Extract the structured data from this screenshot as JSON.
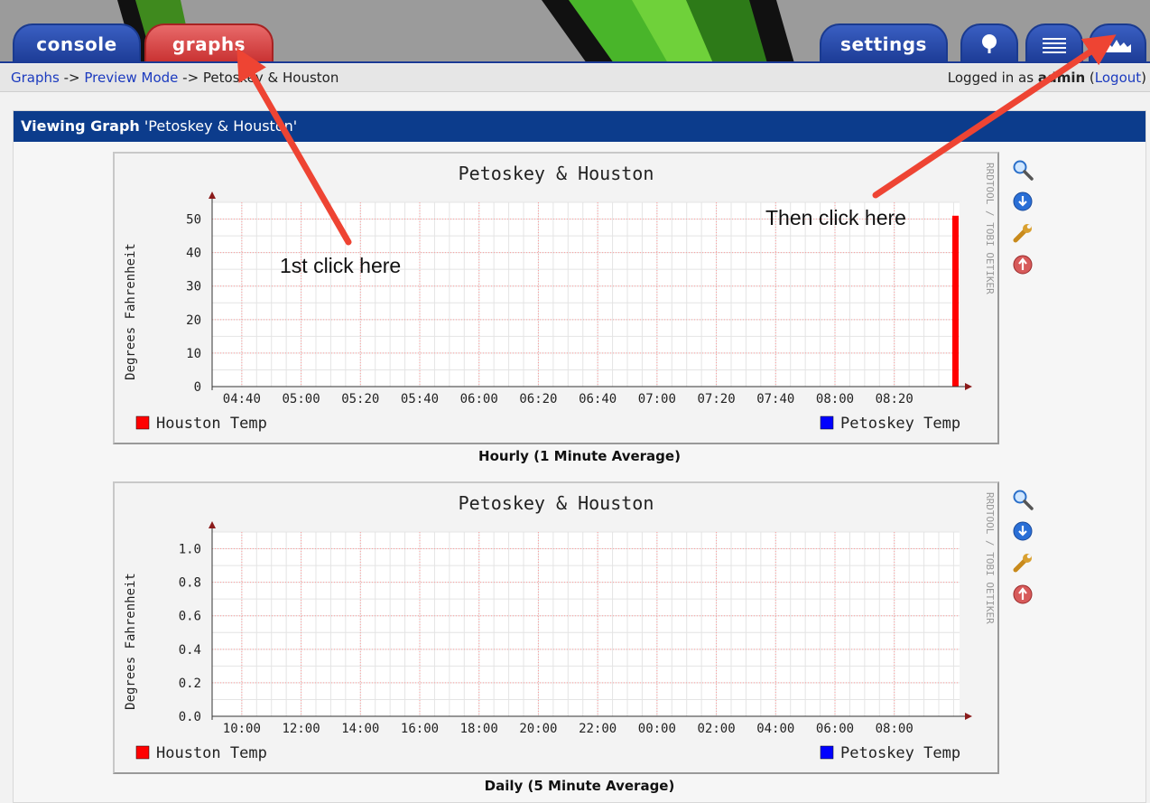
{
  "nav": {
    "tabs": {
      "console": "console",
      "graphs": "graphs",
      "settings": "settings"
    },
    "icon_tabs": [
      "tree-view-icon",
      "list-view-icon",
      "preview-view-icon"
    ]
  },
  "breadcrumb": {
    "graphs": "Graphs",
    "sep1": " -> ",
    "preview": "Preview Mode",
    "sep2": " -> ",
    "current": "Petoskey & Houston"
  },
  "login": {
    "prefix": "Logged in as ",
    "user": "admin",
    "open": " (",
    "logout": "Logout",
    "close": ")"
  },
  "panel": {
    "heading_bold": "Viewing Graph",
    "heading_name": " 'Petoskey & Houston'"
  },
  "graphs": [
    {
      "title": "Petoskey & Houston",
      "ylabel": "Degrees Fahrenheit",
      "vertical_label": "RRDTOOL / TOBI OETIKER",
      "legend_left": "Houston Temp",
      "legend_right": "Petoskey Temp",
      "caption": "Hourly (1 Minute Average)"
    },
    {
      "title": "Petoskey & Houston",
      "ylabel": "Degrees Fahrenheit",
      "vertical_label": "RRDTOOL / TOBI OETIKER",
      "legend_left": "Houston Temp",
      "legend_right": "Petoskey Temp",
      "caption": "Daily (5 Minute Average)"
    }
  ],
  "chart_data": [
    {
      "type": "bar",
      "title": "Petoskey & Houston",
      "ylabel": "Degrees Fahrenheit",
      "xlabel": "",
      "x_ticks": [
        "04:40",
        "05:00",
        "05:20",
        "05:40",
        "06:00",
        "06:20",
        "06:40",
        "07:00",
        "07:20",
        "07:40",
        "08:00",
        "08:20"
      ],
      "y_ticks": [
        "0",
        "10",
        "20",
        "30",
        "40",
        "50"
      ],
      "ylim": [
        0,
        55
      ],
      "series": [
        {
          "name": "Houston Temp",
          "color": "#ff0000",
          "points": [
            {
              "x": "08:24",
              "y": 51
            }
          ]
        },
        {
          "name": "Petoskey Temp",
          "color": "#0000ff",
          "points": []
        }
      ],
      "grid": true,
      "legend": "bottom"
    },
    {
      "type": "line",
      "title": "Petoskey & Houston",
      "ylabel": "Degrees Fahrenheit",
      "xlabel": "",
      "x_ticks": [
        "10:00",
        "12:00",
        "14:00",
        "16:00",
        "18:00",
        "20:00",
        "22:00",
        "00:00",
        "02:00",
        "04:00",
        "06:00",
        "08:00"
      ],
      "y_ticks": [
        "0.0",
        "0.2",
        "0.4",
        "0.6",
        "0.8",
        "1.0"
      ],
      "ylim": [
        0,
        1.1
      ],
      "series": [
        {
          "name": "Houston Temp",
          "color": "#ff0000",
          "points": []
        },
        {
          "name": "Petoskey Temp",
          "color": "#0000ff",
          "points": []
        }
      ],
      "grid": true,
      "legend": "bottom"
    }
  ],
  "annotations": {
    "first": "1st click here",
    "then": "Then click here"
  },
  "colors": {
    "nav_blue": "#1c3b95",
    "tab_red": "#c83030",
    "header_blue": "#0c3c8c",
    "arrow": "#ee4433"
  }
}
